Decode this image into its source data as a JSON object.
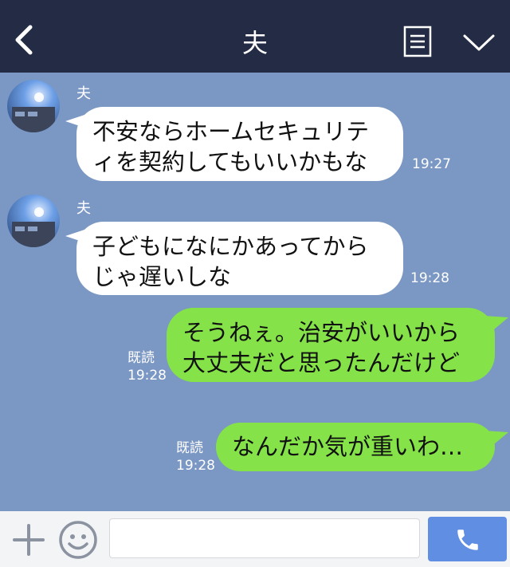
{
  "header": {
    "title": "夫"
  },
  "messages": [
    {
      "sender": "夫",
      "lines": [
        "不安ならホームセキュリテ",
        "ィを契約してもいいかもな"
      ],
      "time": "19:27"
    },
    {
      "sender": "夫",
      "lines": [
        "子どもになにかあってから",
        "じゃ遅いしな"
      ],
      "time": "19:28"
    },
    {
      "lines": [
        "そうねぇ。治安がいいから",
        "大丈夫だと思ったんだけど"
      ],
      "read": "既読",
      "time": "19:28"
    },
    {
      "lines": [
        "なんだか気が重いわ…"
      ],
      "read": "既読",
      "time": "19:28"
    }
  ],
  "input": {
    "placeholder": ""
  },
  "colors": {
    "header_bg": "#232c44",
    "chat_bg": "#7b97c4",
    "incoming_bubble": "#ffffff",
    "outgoing_bubble": "#85e249",
    "call_button": "#5f8ee3"
  },
  "icons": {
    "back": "chevron-left-icon",
    "menu": "list-icon",
    "collapse": "chevron-down-icon",
    "add": "plus-icon",
    "emoji": "smile-icon",
    "call": "phone-icon"
  }
}
